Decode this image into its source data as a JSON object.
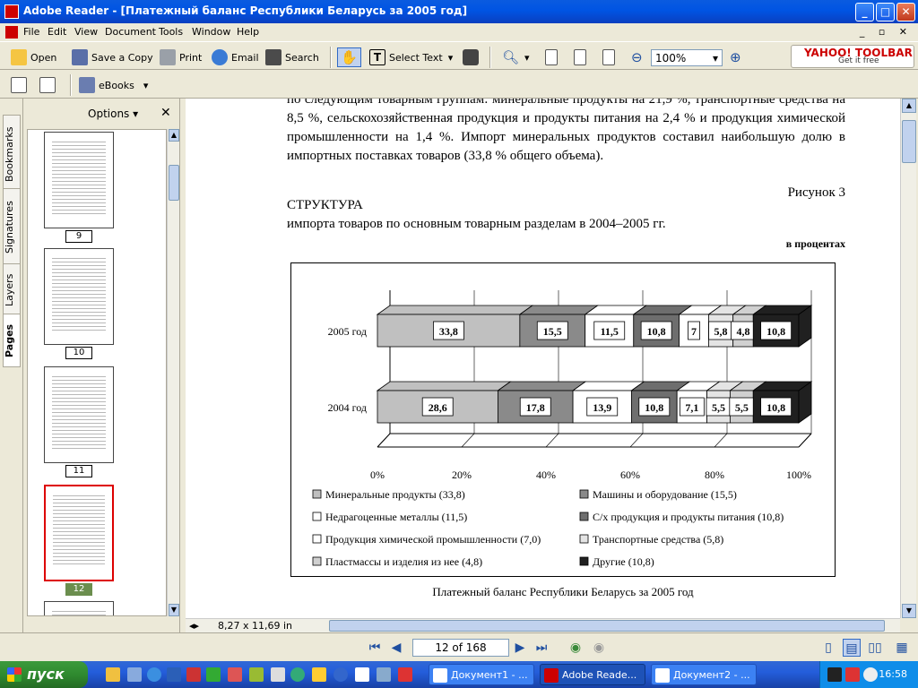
{
  "window": {
    "title": "Adobe Reader - [Платежный баланс Республики Беларусь за 2005 год]"
  },
  "menu": [
    "File",
    "Edit",
    "View",
    "Document",
    "Tools",
    "Window",
    "Help"
  ],
  "toolbar": {
    "open": "Open",
    "save_copy": "Save a Copy",
    "print": "Print",
    "email": "Email",
    "search": "Search",
    "select_text": "Select Text",
    "zoom": "100%",
    "ebooks": "eBooks",
    "yahoo_logo": "YAHOO! TOOLBAR",
    "yahoo_sub": "Get it free"
  },
  "sidebar": {
    "tabs": [
      "Bookmarks",
      "Signatures",
      "Layers",
      "Pages"
    ],
    "options": "Options ▾",
    "thumbs": [
      {
        "label": "9"
      },
      {
        "label": "10"
      },
      {
        "label": "11"
      },
      {
        "label": "12"
      }
    ]
  },
  "doc": {
    "paragraph": "по следующим товарным группам: минеральные продукты на 21,9 %, транспортные средства на 8,5 %, сельскохозяйственная продукция и продукты питания на 2,4 % и продукция химической промышленности на 1,4 %. Импорт минеральных продуктов составил наибольшую долю в импортных поставках товаров (33,8 % общего объема).",
    "figure_no": "Рисунок 3",
    "heading": "СТРУКТУРА",
    "subheading": "импорта товаров по основным товарным разделам в 2004–2005 гг.",
    "units": "в процентах",
    "caption": "Платежный баланс Республики Беларусь за 2005 год"
  },
  "chart_data": {
    "type": "bar",
    "stacked": true,
    "orientation": "horizontal",
    "categories": [
      "2005 год",
      "2004 год"
    ],
    "xticks": [
      "0%",
      "20%",
      "40%",
      "60%",
      "80%",
      "100%"
    ],
    "xlim": [
      0,
      100
    ],
    "series": [
      {
        "name": "Минеральные продукты (33,8)",
        "values": [
          33.8,
          28.6
        ],
        "color": "#c0c0c0"
      },
      {
        "name": "Машины и оборудование (15,5)",
        "values": [
          15.5,
          17.8
        ],
        "color": "#8a8a8a"
      },
      {
        "name": "Недрагоценные металлы (11,5)",
        "values": [
          11.5,
          13.9
        ],
        "color": "#ffffff"
      },
      {
        "name": "С/х продукция и продукты питания (10,8)",
        "values": [
          10.8,
          10.8
        ],
        "color": "#6e6e6e"
      },
      {
        "name": "Продукция химической промышленности (7,0)",
        "values": [
          7,
          7.1
        ],
        "color": "#ffffff"
      },
      {
        "name": "Транспортные средства (5,8)",
        "values": [
          5.8,
          5.5
        ],
        "color": "#e4e4e4"
      },
      {
        "name": "Пластмассы и изделия из нее (4,8)",
        "values": [
          4.8,
          5.5
        ],
        "color": "#d0d0d0"
      },
      {
        "name": "Другие (10,8)",
        "values": [
          10.8,
          10.8
        ],
        "color": "#202020"
      }
    ],
    "data_labels": [
      [
        "33,8",
        "15,5",
        "11,5",
        "10,8",
        "7",
        "5,8",
        "4,8",
        "10,8"
      ],
      [
        "28,6",
        "17,8",
        "13,9",
        "10,8",
        "7,1",
        "5,5",
        "5,5",
        "10,8"
      ]
    ]
  },
  "status": {
    "page_size": "8,27 x 11,69 in",
    "page_of": "12 of 168"
  },
  "taskbar": {
    "start": "пуск",
    "tasks": [
      "Документ1 - ...",
      "Adobe Reade...",
      "Документ2 - ..."
    ],
    "clock": "16:58"
  }
}
